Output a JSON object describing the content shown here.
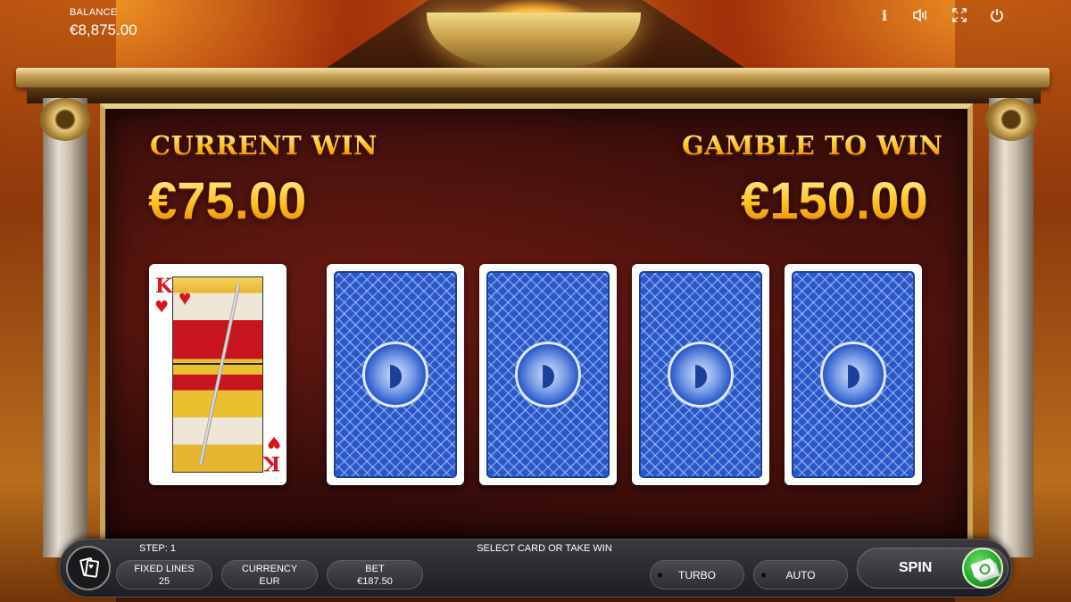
{
  "hud": {
    "balance_label": "BALANCE",
    "balance_value": "€8,875.00",
    "icons": [
      "info-icon",
      "sound-icon",
      "fullscreen-icon",
      "power-icon"
    ],
    "info_glyph": "i"
  },
  "gamble": {
    "current_win_label": "CURRENT WIN",
    "current_win_amount": "€75.00",
    "gamble_to_win_label": "GAMBLE TO WIN",
    "gamble_to_win_amount": "€150.00",
    "dealer_card": {
      "rank": "K",
      "suit": "♥",
      "suit_name": "hearts",
      "face_up": true
    },
    "choice_cards": [
      {
        "face_up": false
      },
      {
        "face_up": false
      },
      {
        "face_up": false
      },
      {
        "face_up": false
      }
    ]
  },
  "status": {
    "step_text": "STEP: 1",
    "hint_text": "SELECT CARD OR TAKE WIN"
  },
  "controls": {
    "fixed_lines_label": "FIXED LINES",
    "fixed_lines_value": "25",
    "currency_label": "CURRENCY",
    "currency_value": "EUR",
    "bet_label": "BET",
    "bet_value": "€187.50",
    "turbo_label": "TURBO",
    "auto_label": "AUTO",
    "spin_label": "SPIN"
  },
  "colors": {
    "win_gold": "#ffc830",
    "card_back_blue": "#2a58c8",
    "spin_green": "#25a82a",
    "heart_red": "#d8141c"
  }
}
